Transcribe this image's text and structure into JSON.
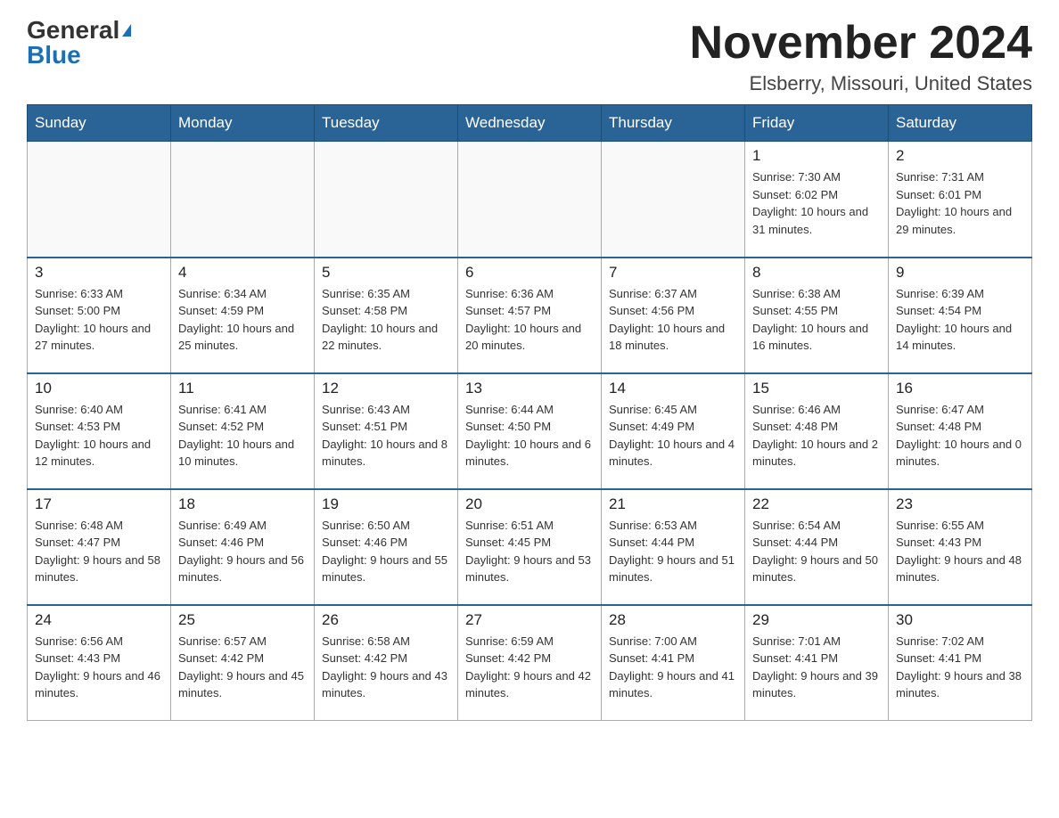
{
  "header": {
    "logo_general": "General",
    "logo_blue": "Blue",
    "month_title": "November 2024",
    "location": "Elsberry, Missouri, United States"
  },
  "days_of_week": [
    "Sunday",
    "Monday",
    "Tuesday",
    "Wednesday",
    "Thursday",
    "Friday",
    "Saturday"
  ],
  "weeks": [
    {
      "days": [
        {
          "number": "",
          "info": ""
        },
        {
          "number": "",
          "info": ""
        },
        {
          "number": "",
          "info": ""
        },
        {
          "number": "",
          "info": ""
        },
        {
          "number": "",
          "info": ""
        },
        {
          "number": "1",
          "info": "Sunrise: 7:30 AM\nSunset: 6:02 PM\nDaylight: 10 hours and 31 minutes."
        },
        {
          "number": "2",
          "info": "Sunrise: 7:31 AM\nSunset: 6:01 PM\nDaylight: 10 hours and 29 minutes."
        }
      ]
    },
    {
      "days": [
        {
          "number": "3",
          "info": "Sunrise: 6:33 AM\nSunset: 5:00 PM\nDaylight: 10 hours and 27 minutes."
        },
        {
          "number": "4",
          "info": "Sunrise: 6:34 AM\nSunset: 4:59 PM\nDaylight: 10 hours and 25 minutes."
        },
        {
          "number": "5",
          "info": "Sunrise: 6:35 AM\nSunset: 4:58 PM\nDaylight: 10 hours and 22 minutes."
        },
        {
          "number": "6",
          "info": "Sunrise: 6:36 AM\nSunset: 4:57 PM\nDaylight: 10 hours and 20 minutes."
        },
        {
          "number": "7",
          "info": "Sunrise: 6:37 AM\nSunset: 4:56 PM\nDaylight: 10 hours and 18 minutes."
        },
        {
          "number": "8",
          "info": "Sunrise: 6:38 AM\nSunset: 4:55 PM\nDaylight: 10 hours and 16 minutes."
        },
        {
          "number": "9",
          "info": "Sunrise: 6:39 AM\nSunset: 4:54 PM\nDaylight: 10 hours and 14 minutes."
        }
      ]
    },
    {
      "days": [
        {
          "number": "10",
          "info": "Sunrise: 6:40 AM\nSunset: 4:53 PM\nDaylight: 10 hours and 12 minutes."
        },
        {
          "number": "11",
          "info": "Sunrise: 6:41 AM\nSunset: 4:52 PM\nDaylight: 10 hours and 10 minutes."
        },
        {
          "number": "12",
          "info": "Sunrise: 6:43 AM\nSunset: 4:51 PM\nDaylight: 10 hours and 8 minutes."
        },
        {
          "number": "13",
          "info": "Sunrise: 6:44 AM\nSunset: 4:50 PM\nDaylight: 10 hours and 6 minutes."
        },
        {
          "number": "14",
          "info": "Sunrise: 6:45 AM\nSunset: 4:49 PM\nDaylight: 10 hours and 4 minutes."
        },
        {
          "number": "15",
          "info": "Sunrise: 6:46 AM\nSunset: 4:48 PM\nDaylight: 10 hours and 2 minutes."
        },
        {
          "number": "16",
          "info": "Sunrise: 6:47 AM\nSunset: 4:48 PM\nDaylight: 10 hours and 0 minutes."
        }
      ]
    },
    {
      "days": [
        {
          "number": "17",
          "info": "Sunrise: 6:48 AM\nSunset: 4:47 PM\nDaylight: 9 hours and 58 minutes."
        },
        {
          "number": "18",
          "info": "Sunrise: 6:49 AM\nSunset: 4:46 PM\nDaylight: 9 hours and 56 minutes."
        },
        {
          "number": "19",
          "info": "Sunrise: 6:50 AM\nSunset: 4:46 PM\nDaylight: 9 hours and 55 minutes."
        },
        {
          "number": "20",
          "info": "Sunrise: 6:51 AM\nSunset: 4:45 PM\nDaylight: 9 hours and 53 minutes."
        },
        {
          "number": "21",
          "info": "Sunrise: 6:53 AM\nSunset: 4:44 PM\nDaylight: 9 hours and 51 minutes."
        },
        {
          "number": "22",
          "info": "Sunrise: 6:54 AM\nSunset: 4:44 PM\nDaylight: 9 hours and 50 minutes."
        },
        {
          "number": "23",
          "info": "Sunrise: 6:55 AM\nSunset: 4:43 PM\nDaylight: 9 hours and 48 minutes."
        }
      ]
    },
    {
      "days": [
        {
          "number": "24",
          "info": "Sunrise: 6:56 AM\nSunset: 4:43 PM\nDaylight: 9 hours and 46 minutes."
        },
        {
          "number": "25",
          "info": "Sunrise: 6:57 AM\nSunset: 4:42 PM\nDaylight: 9 hours and 45 minutes."
        },
        {
          "number": "26",
          "info": "Sunrise: 6:58 AM\nSunset: 4:42 PM\nDaylight: 9 hours and 43 minutes."
        },
        {
          "number": "27",
          "info": "Sunrise: 6:59 AM\nSunset: 4:42 PM\nDaylight: 9 hours and 42 minutes."
        },
        {
          "number": "28",
          "info": "Sunrise: 7:00 AM\nSunset: 4:41 PM\nDaylight: 9 hours and 41 minutes."
        },
        {
          "number": "29",
          "info": "Sunrise: 7:01 AM\nSunset: 4:41 PM\nDaylight: 9 hours and 39 minutes."
        },
        {
          "number": "30",
          "info": "Sunrise: 7:02 AM\nSunset: 4:41 PM\nDaylight: 9 hours and 38 minutes."
        }
      ]
    }
  ]
}
